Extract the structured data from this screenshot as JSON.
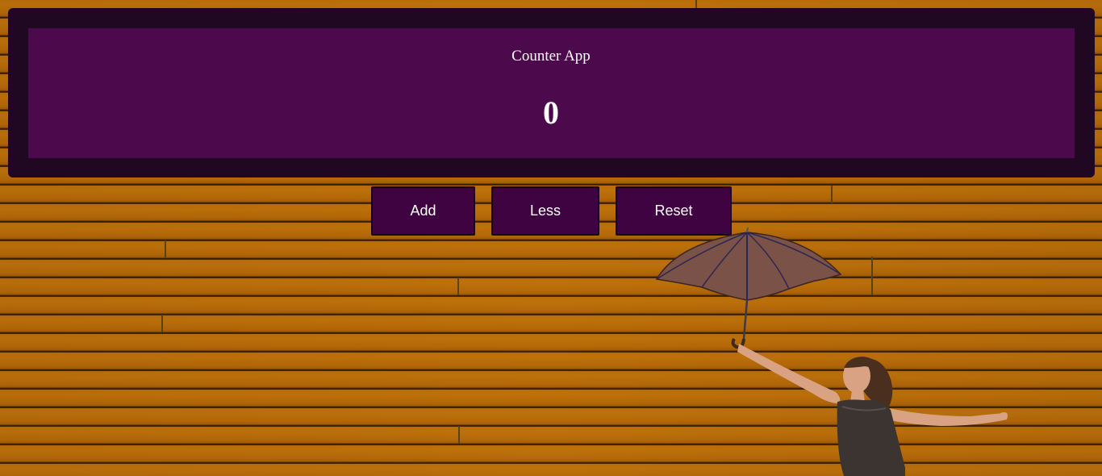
{
  "app": {
    "title": "Counter App",
    "count": "0"
  },
  "buttons": {
    "add_label": "Add",
    "less_label": "Less",
    "reset_label": "Reset"
  },
  "colors": {
    "wall": "#d8a52f",
    "card_outer": "#200823",
    "card_inner": "#4c0a4c",
    "button": "#400342",
    "text": "#ffffff"
  }
}
